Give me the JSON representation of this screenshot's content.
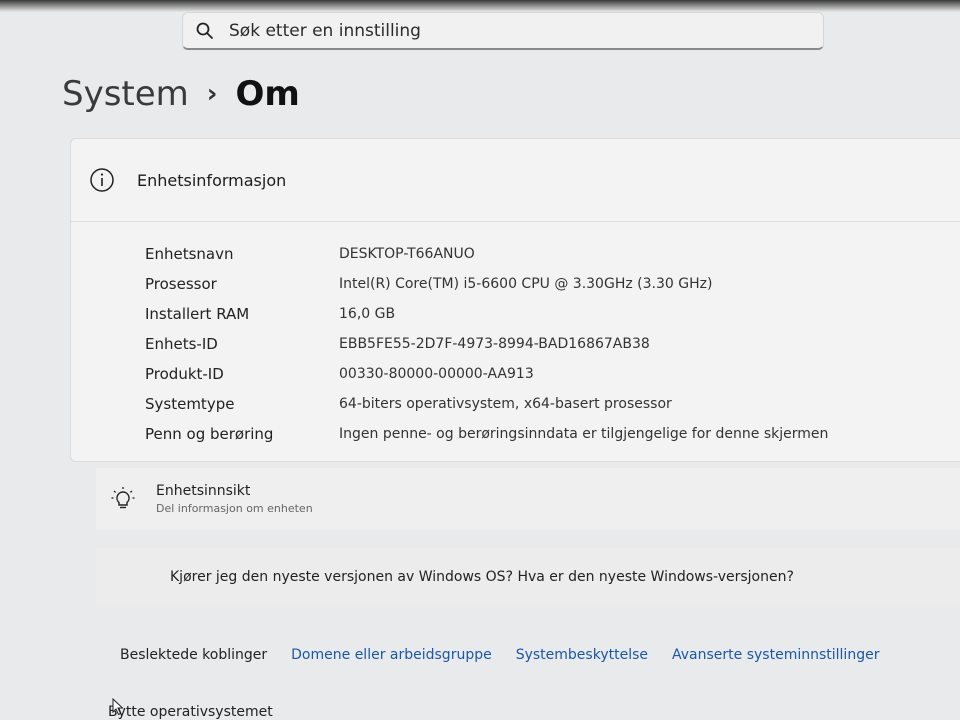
{
  "search": {
    "placeholder": "Søk etter en innstilling"
  },
  "breadcrumb": {
    "parent": "System",
    "separator": "›",
    "current": "Om"
  },
  "device_info": {
    "title": "Enhetsinformasjon",
    "rows": [
      {
        "label": "Enhetsnavn",
        "value": "DESKTOP-T66ANUO"
      },
      {
        "label": "Prosessor",
        "value": "Intel(R) Core(TM) i5-6600 CPU @ 3.30GHz (3.30 GHz)"
      },
      {
        "label": "Installert RAM",
        "value": "16,0 GB"
      },
      {
        "label": "Enhets-ID",
        "value": "EBB5FE55-2D7F-4973-8994-BAD16867AB38"
      },
      {
        "label": "Produkt-ID",
        "value": "00330-80000-00000-AA913"
      },
      {
        "label": "Systemtype",
        "value": "64-biters operativsystem, x64-basert prosessor"
      },
      {
        "label": "Penn og berøring",
        "value": "Ingen penne- og berøringsinndata er tilgjengelige for denne skjermen"
      }
    ]
  },
  "insight": {
    "title": "Enhetsinnsikt",
    "subtitle": "Del informasjon om enheten"
  },
  "windows_question": "Kjører jeg den nyeste versjonen av Windows OS? Hva er den nyeste Windows-versjonen?",
  "related": {
    "label": "Beslektede koblinger",
    "links": [
      "Domene eller arbeidsgruppe",
      "Systembeskyttelse",
      "Avanserte systeminnstillinger"
    ]
  },
  "bottom_item": "Bytte operativsystemet",
  "colors": {
    "link": "#1a57a8",
    "card": "#f3f3f4",
    "background": "#e9eaeb"
  }
}
